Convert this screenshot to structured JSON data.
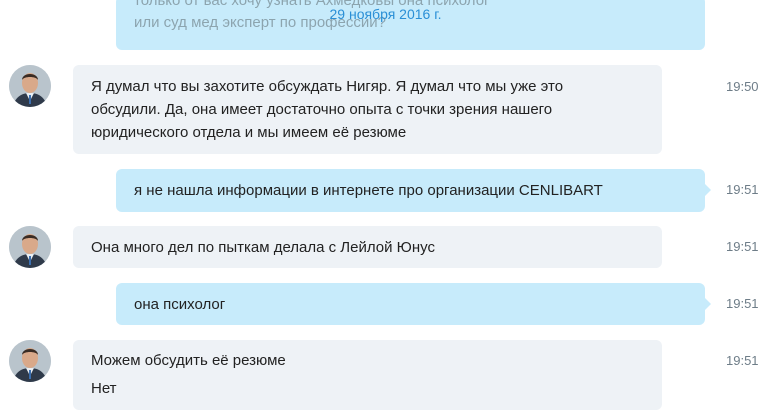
{
  "date_separator": "29 ноября 2016 г.",
  "partial_message": {
    "line1": "только от вас хочу узнать                   Ахмедковы она психолог",
    "line2": "или суд мед эксперт по профессии?"
  },
  "messages": [
    {
      "direction": "incoming",
      "avatar": "contact-avatar",
      "lines": [
        "Я думал что вы захотите обсуждать Нигяр. Я думал что мы уже это",
        "обсудили. Да, она имеет достаточно опыта с точки зрения нашего",
        "юридического отдела и мы имеем её резюме"
      ],
      "time": "19:50"
    },
    {
      "direction": "outgoing",
      "lines": [
        "я не нашла информации в интернете про организации CENLIBART"
      ],
      "time": "19:51"
    },
    {
      "direction": "incoming",
      "avatar": "contact-avatar",
      "lines": [
        "Она много дел по пыткам делала с Лейлой Юнус"
      ],
      "time": "19:51"
    },
    {
      "direction": "outgoing",
      "lines": [
        "она психолог"
      ],
      "time": "19:51"
    },
    {
      "direction": "incoming",
      "avatar": "contact-avatar",
      "lines": [
        "Можем обсудить её резюме",
        "Нет"
      ],
      "time": "19:51"
    }
  ],
  "colors": {
    "incoming_bubble": "#eef2f6",
    "outgoing_bubble": "#c7ebfb",
    "date_text": "#2a8fd6",
    "time_text": "#6e7d88"
  }
}
